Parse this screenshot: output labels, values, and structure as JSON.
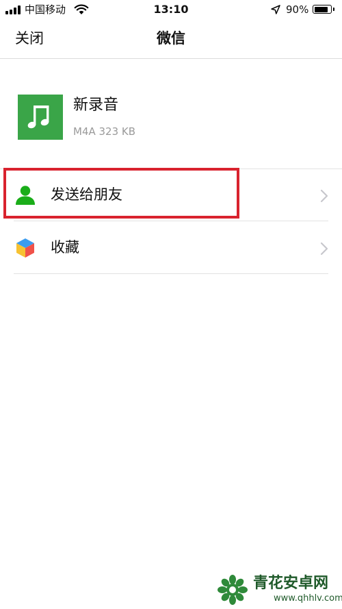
{
  "status_bar": {
    "carrier": "中国移动",
    "time": "13:10",
    "battery_percent": "90%",
    "battery_level": 0.9,
    "icons": [
      "signal-icon",
      "wifi-icon",
      "location-icon",
      "battery-icon"
    ]
  },
  "nav": {
    "close_label": "关闭",
    "title": "微信"
  },
  "file": {
    "name": "新录音",
    "meta": "M4A 323 KB",
    "icon": "music-note-icon",
    "icon_color": "#3aa548"
  },
  "actions": [
    {
      "label": "发送给朋友",
      "icon": "contact-person-icon",
      "icon_color": "#1aad19",
      "highlighted": true
    },
    {
      "label": "收藏",
      "icon": "favorites-cube-icon",
      "highlighted": false
    }
  ],
  "highlight_color": "#d9232e",
  "watermark": {
    "title": "青花安卓网",
    "url": "www.qhhlv.com"
  }
}
